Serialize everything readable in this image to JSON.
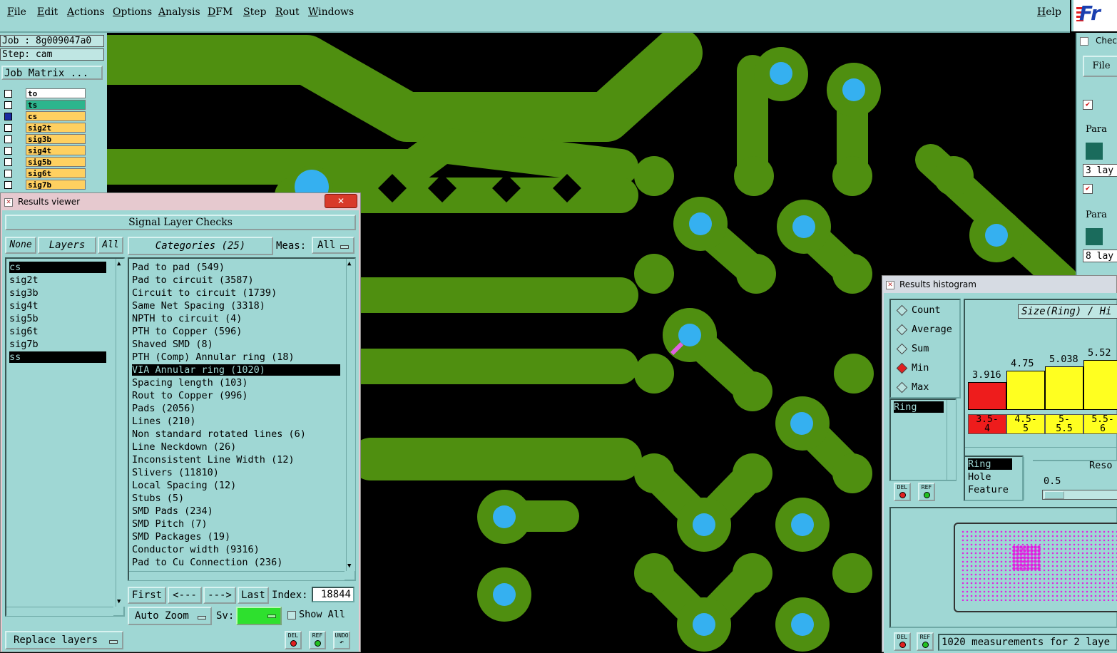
{
  "menu": {
    "items": [
      "File",
      "Edit",
      "Actions",
      "Options",
      "Analysis",
      "DFM",
      "Step",
      "Rout",
      "Windows"
    ],
    "help": "Help",
    "logo": "Fr"
  },
  "left_panel": {
    "job": "Job : 8g009047a0",
    "step": "Step: cam",
    "job_matrix": "Job Matrix ...",
    "layers": [
      {
        "name": "to",
        "color": "#ffffff"
      },
      {
        "name": "ts",
        "color": "#2db58d"
      },
      {
        "name": "cs",
        "color": "#ffd060"
      },
      {
        "name": "sig2t",
        "color": "#ffd060"
      },
      {
        "name": "sig3b",
        "color": "#ffd060"
      },
      {
        "name": "sig4t",
        "color": "#ffd060"
      },
      {
        "name": "sig5b",
        "color": "#ffd060"
      },
      {
        "name": "sig6t",
        "color": "#ffd060"
      },
      {
        "name": "sig7b",
        "color": "#ffd060"
      }
    ]
  },
  "results_viewer": {
    "title": "Results viewer",
    "header": "Signal Layer Checks",
    "none_button": "None",
    "layers_button": "Layers",
    "all_button": "All",
    "categories_button": "Categories (25)",
    "meas_label": "Meas:",
    "meas_value": "All",
    "layer_list": [
      "cs",
      "sig2t",
      "sig3b",
      "sig4t",
      "sig5b",
      "sig6t",
      "sig7b",
      "ss"
    ],
    "categories": [
      "Pad to pad (549)",
      "Pad to circuit (3587)",
      "Circuit to circuit (1739)",
      "Same Net Spacing (3318)",
      "NPTH to circuit (4)",
      "PTH to Copper (596)",
      "Shaved SMD (8)",
      "PTH (Comp) Annular ring (18)",
      "VIA Annular ring (1020)",
      "Spacing length (103)",
      "Rout to Copper (996)",
      "Pads (2056)",
      "Lines (210)",
      "Non standard rotated lines (6)",
      "Line Neckdown (26)",
      "Inconsistent Line Width (12)",
      "Slivers (11810)",
      "Local Spacing (12)",
      "Stubs (5)",
      "SMD Pads (234)",
      "SMD Pitch (7)",
      "SMD Packages (19)",
      "Conductor width (9316)",
      "Pad to Cu Connection (236)"
    ],
    "nav": {
      "first": "First",
      "prev": "<---",
      "next": "--->",
      "last": "Last",
      "index_label": "Index:",
      "index_value": "18844"
    },
    "auto_zoom": "Auto Zoom",
    "sv_label": "Sv:",
    "show_all": "Show All",
    "replace_layers": "Replace layers",
    "icon_buttons": [
      "DEL",
      "REF",
      "UNDO"
    ]
  },
  "results_histogram": {
    "title": "Results histogram",
    "modes": [
      "Count",
      "Average",
      "Sum",
      "Min",
      "Max"
    ],
    "selected_mode": "Min",
    "axis_title": "Size(Ring) / Hi",
    "bars": [
      {
        "value": "3.916",
        "range": "3.5-\n4",
        "color": "#ee1c1c"
      },
      {
        "value": "4.75",
        "range": "4.5-\n5",
        "color": "#ffff20"
      },
      {
        "value": "5.038",
        "range": "5-\n5.5",
        "color": "#ffff20"
      },
      {
        "value": "5.52",
        "range": "5.5-\n6",
        "color": "#ffff20"
      }
    ],
    "measure_list": [
      "Ring"
    ],
    "attr_list": [
      "Ring",
      "Hole",
      "Feature"
    ],
    "resolution_label": "Reso",
    "resolution_value": "0.5",
    "status": "1020 measurements for 2 laye",
    "icon_buttons": [
      "DEL",
      "REF"
    ]
  },
  "checklist_stub": {
    "title": "Chec",
    "file": "File",
    "param": "Para",
    "layers1": "3 lay",
    "layers2": "8 lay"
  }
}
